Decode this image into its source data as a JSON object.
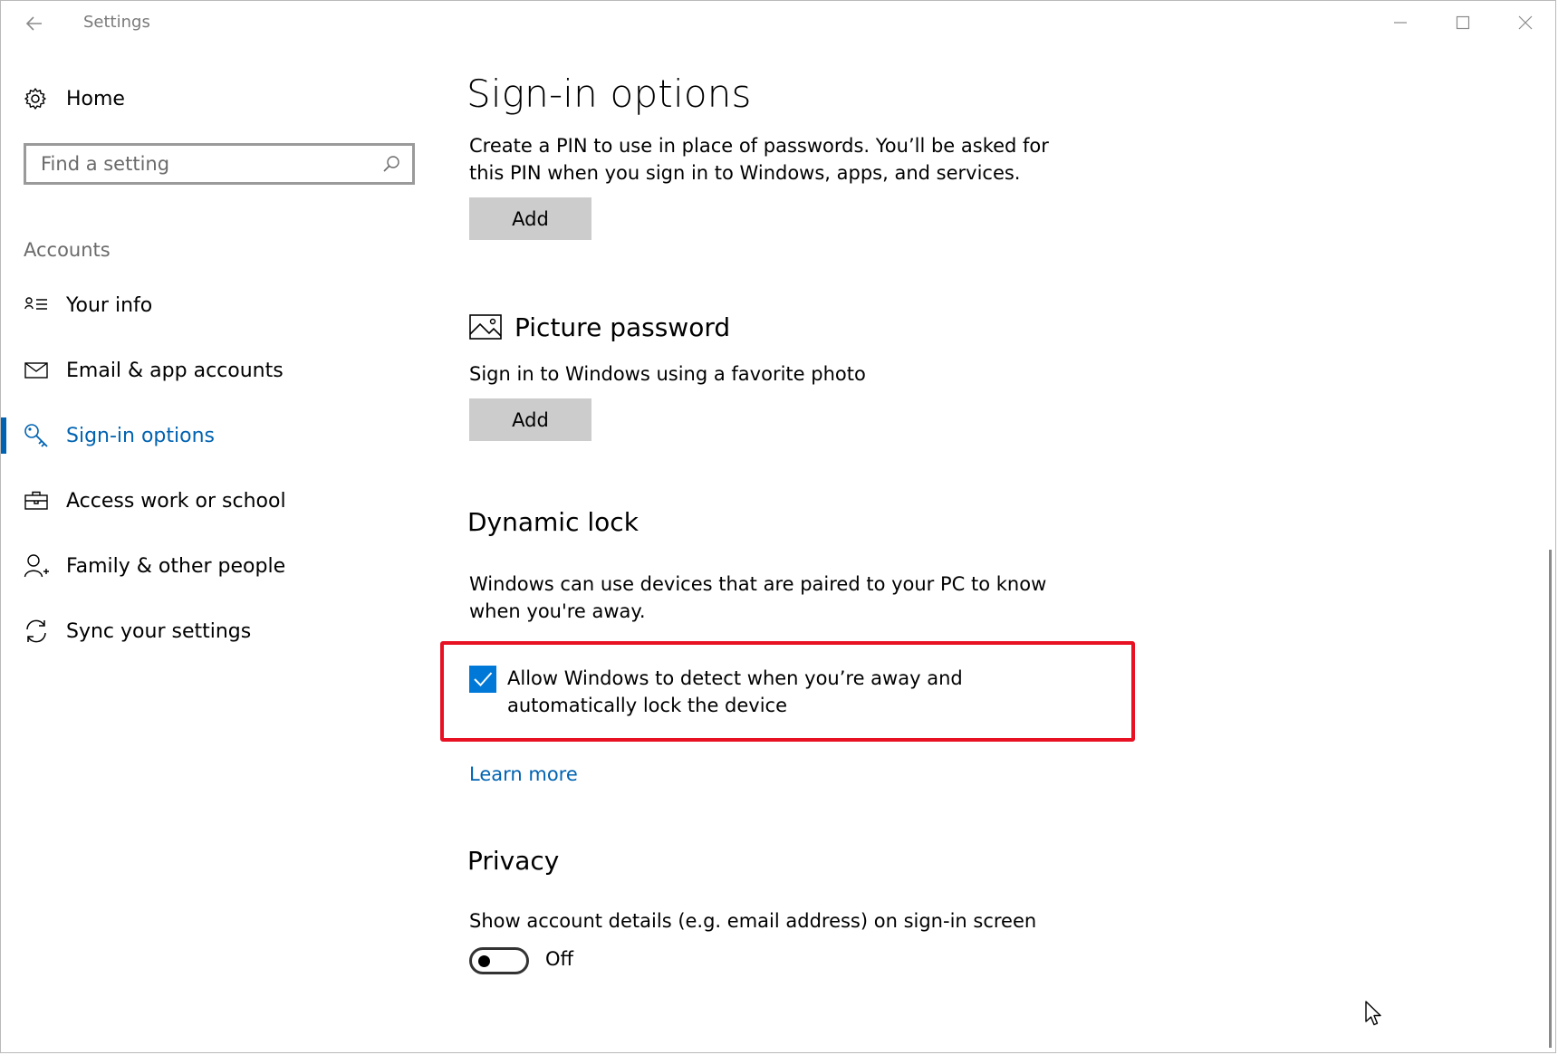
{
  "window": {
    "title": "Settings"
  },
  "sidebar": {
    "home_label": "Home",
    "search_placeholder": "Find a setting",
    "section_label": "Accounts",
    "items": [
      {
        "label": "Your info",
        "icon": "person-card-icon",
        "active": false
      },
      {
        "label": "Email & app accounts",
        "icon": "mail-icon",
        "active": false
      },
      {
        "label": "Sign-in options",
        "icon": "key-icon",
        "active": true
      },
      {
        "label": "Access work or school",
        "icon": "briefcase-icon",
        "active": false
      },
      {
        "label": "Family & other people",
        "icon": "person-add-icon",
        "active": false
      },
      {
        "label": "Sync your settings",
        "icon": "sync-icon",
        "active": false
      }
    ]
  },
  "main": {
    "title": "Sign-in options",
    "pin": {
      "description": "Create a PIN to use in place of passwords. You’ll be asked for this PIN when you sign in to Windows, apps, and services.",
      "button_label": "Add"
    },
    "picture_password": {
      "heading": "Picture password",
      "description": "Sign in to Windows using a favorite photo",
      "button_label": "Add"
    },
    "dynamic_lock": {
      "heading": "Dynamic lock",
      "description": "Windows can use devices that are paired to your PC to know when you're away.",
      "checkbox_label": "Allow Windows to detect when you’re away and automatically lock the device",
      "checkbox_checked": true,
      "link_label": "Learn more"
    },
    "privacy": {
      "heading": "Privacy",
      "description": "Show account details (e.g. email address) on sign-in screen",
      "toggle_state": "Off",
      "toggle_on": false
    }
  },
  "colors": {
    "accent": "#0063b1",
    "checkbox": "#0078d7",
    "highlight_border": "#e81123",
    "button_bg": "#cccccc"
  }
}
